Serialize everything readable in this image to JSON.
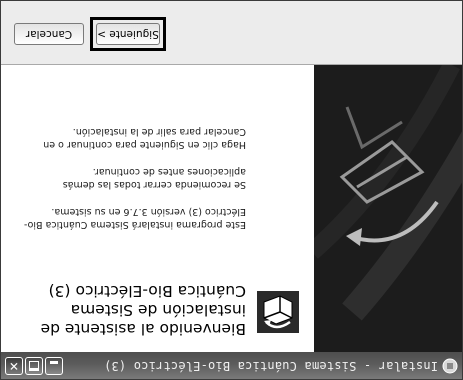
{
  "window": {
    "title": "Instalar - Sistema Cuántica Bio-Eléctrico (3)",
    "controls": {
      "minimize_icon": "minimize-icon",
      "maximize_icon": "maximize-icon",
      "close_symbol": "✕"
    }
  },
  "content": {
    "title": "Bienvenido al asistente de instalación de Sistema Cuántica Bio-Eléctrico (3)",
    "paragraphs": [
      "Este programa instalará Sistema Cuántica Bio-Eléctrico (3) versión 3.7.6 en su sistema.",
      "Se recomienda cerrar todas las demás aplicaciones antes de continuar.",
      "Haga clic en Siguiente para continuar o en Cancelar para salir de la instalación."
    ]
  },
  "buttons": {
    "next": "Siguiente >",
    "cancel": "Cancelar"
  },
  "colors": {
    "titlebar": "#5c5c5c",
    "sidebar": "#1c1c1c",
    "footer": "#ececec",
    "highlight": "#000000"
  },
  "icons": {
    "app": "installer-app-icon",
    "wizard": "installer-box-icon",
    "sidebar_art": "folder-arrow-icon"
  }
}
